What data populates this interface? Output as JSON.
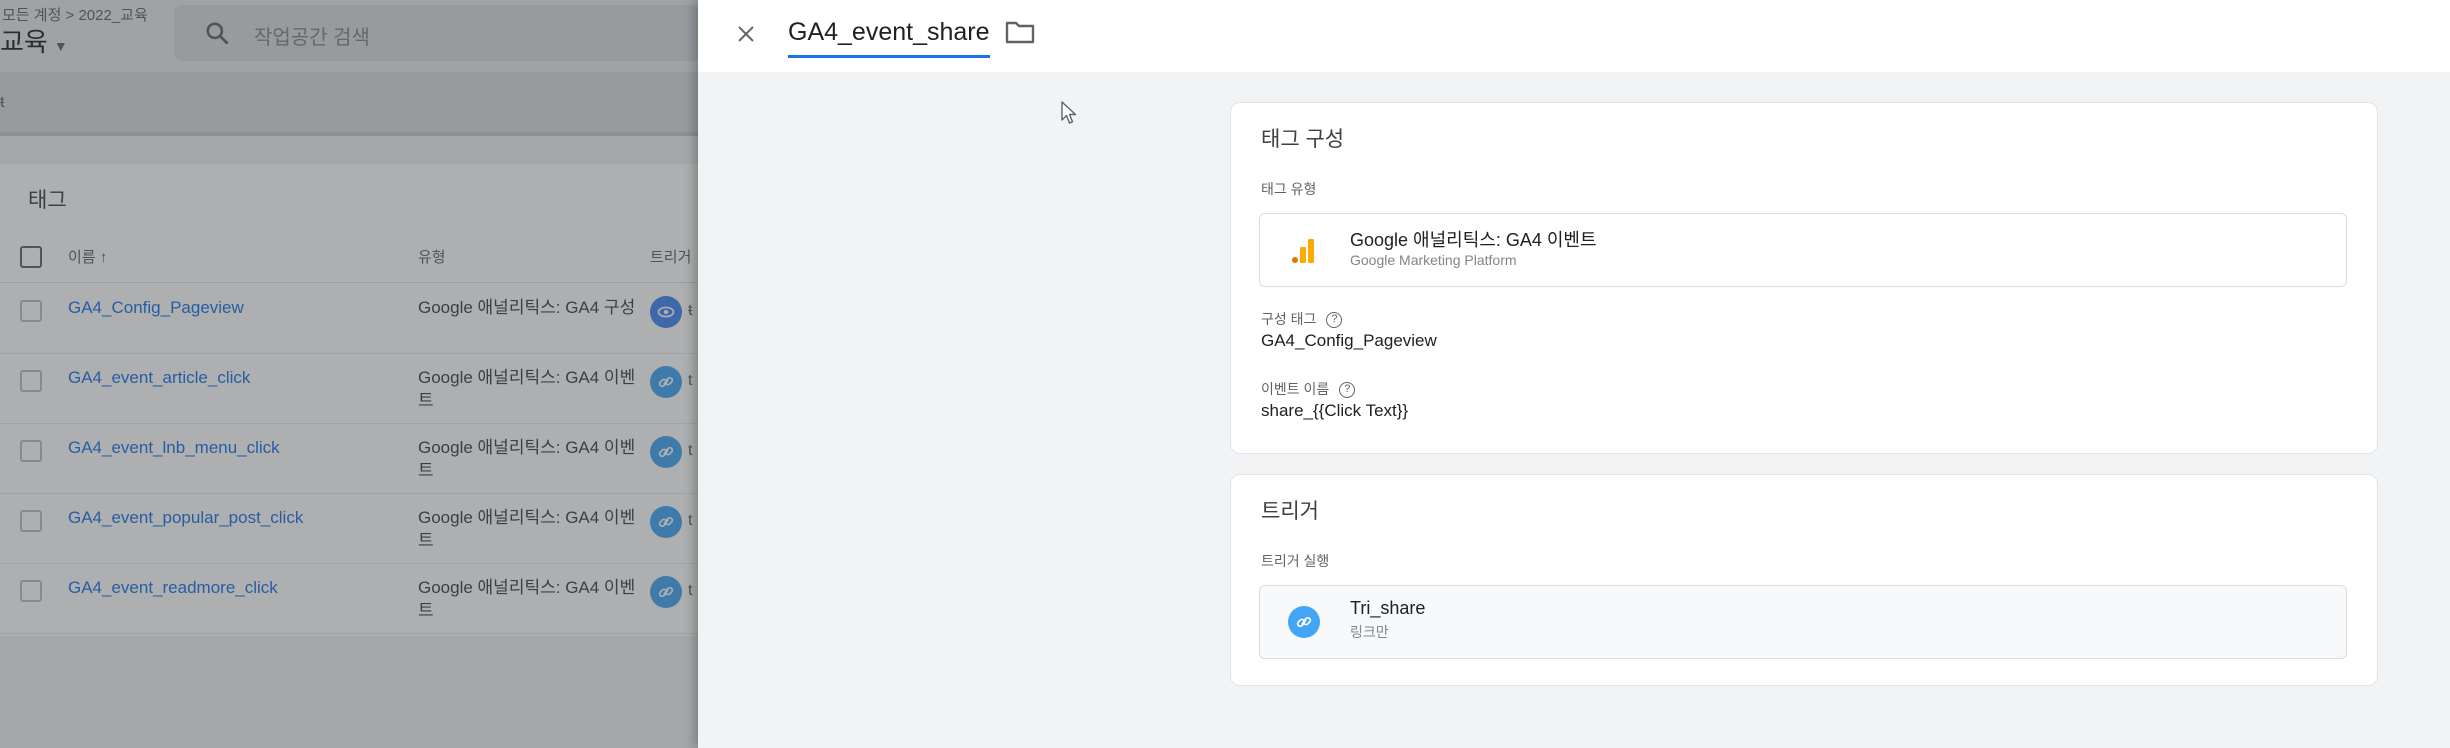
{
  "background": {
    "breadcrumb": "모든 계정 > 2022_교육",
    "workspace_name": "교육",
    "search_placeholder": "작업공간 검색",
    "strip_glyph": "ŧ",
    "tags_title": "태그",
    "columns": {
      "name": "이름 ↑",
      "type": "유형",
      "trigger": "트리거"
    },
    "rows": [
      {
        "name": "GA4_Config_Pageview",
        "type": "Google 애널리틱스: GA4 구성",
        "trigger_icon": "eye-icon",
        "trigger_extra": "ŧ"
      },
      {
        "name": "GA4_event_article_click",
        "type": "Google 애널리틱스: GA4 이벤트",
        "trigger_icon": "link-icon",
        "trigger_extra": "t"
      },
      {
        "name": "GA4_event_lnb_menu_click",
        "type": "Google 애널리틱스: GA4 이벤트",
        "trigger_icon": "link-icon",
        "trigger_extra": "t"
      },
      {
        "name": "GA4_event_popular_post_click",
        "type": "Google 애널리틱스: GA4 이벤트",
        "trigger_icon": "link-icon",
        "trigger_extra": "t"
      },
      {
        "name": "GA4_event_readmore_click",
        "type": "Google 애널리틱스: GA4 이벤트",
        "trigger_icon": "link-icon",
        "trigger_extra": "t"
      }
    ]
  },
  "panel": {
    "title": "GA4_event_share",
    "tag_config": {
      "title": "태그 구성",
      "type_label": "태그 유형",
      "type_name": "Google 애널리틱스: GA4 이벤트",
      "type_vendor": "Google Marketing Platform",
      "config_tag_label": "구성 태그",
      "config_tag_value": "GA4_Config_Pageview",
      "event_name_label": "이벤트 이름",
      "event_name_value": "share_{{Click Text}}",
      "help_glyph": "?"
    },
    "trigger": {
      "title": "트리거",
      "firing_label": "트리거 실행",
      "trigger_name": "Tri_share",
      "trigger_type": "링크만"
    }
  },
  "colors": {
    "accent": "#1a73e8",
    "ga_orange": "#f9ab00",
    "ga_orange_dark": "#e37400",
    "trigger_link": "#42a5f5"
  }
}
